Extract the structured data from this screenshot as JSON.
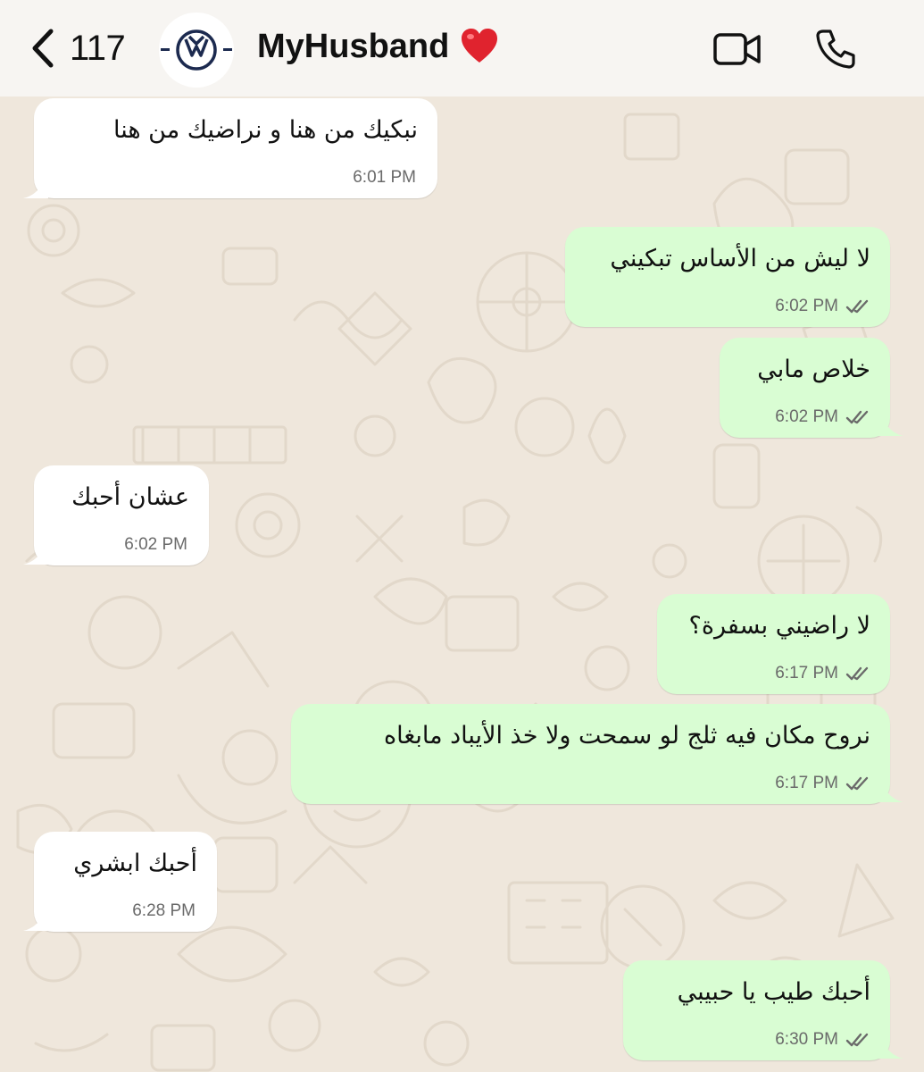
{
  "header": {
    "back_count": "117",
    "contact_name": "MyHusband",
    "icons": [
      "chevron-left-icon",
      "volkswagen-logo",
      "heart-emoji",
      "video-call-icon",
      "phone-icon"
    ]
  },
  "colors": {
    "incoming_bubble": "#ffffff",
    "outgoing_bubble": "#d9fdd3",
    "chat_background": "#efe7dc",
    "header_background": "#f7f5f2",
    "read_ticks": "#6a6a6a"
  },
  "messages": [
    {
      "direction": "in",
      "text": "نبكيك  من هنا و نراضيك من هنا",
      "time": "6:01 PM"
    },
    {
      "direction": "out",
      "text": "لا ليش من الأساس تبكيني",
      "time": "6:02 PM",
      "status": "read"
    },
    {
      "direction": "out",
      "text": "خلاص مابي",
      "time": "6:02 PM",
      "status": "read"
    },
    {
      "direction": "in",
      "text": "عشان أحبك",
      "time": "6:02 PM"
    },
    {
      "direction": "out",
      "text": "لا راضيني بسفرة؟",
      "time": "6:17 PM",
      "status": "read"
    },
    {
      "direction": "out",
      "text": "نروح مكان فيه ثلج لو سمحت ولا خذ الأيباد مابغاه",
      "time": "6:17 PM",
      "status": "read"
    },
    {
      "direction": "in",
      "text": "أحبك ابشري",
      "time": "6:28 PM"
    },
    {
      "direction": "out",
      "text": "أحبك طيب يا حبيبي",
      "time": "6:30 PM",
      "status": "read"
    }
  ]
}
